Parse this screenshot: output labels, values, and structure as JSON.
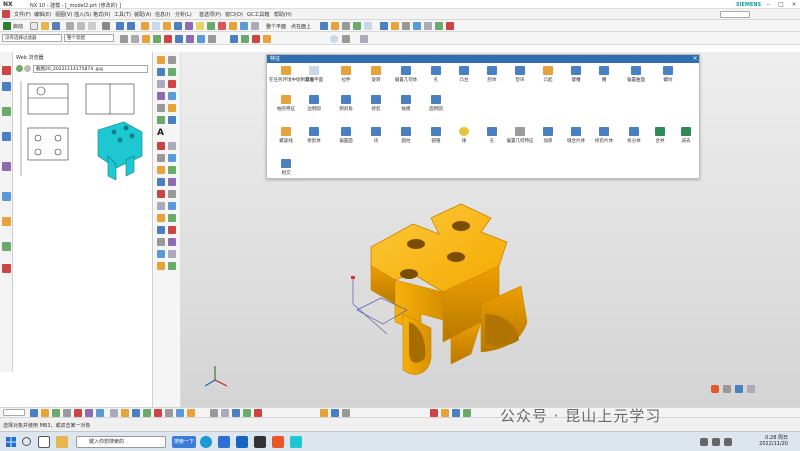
{
  "window": {
    "app_logo": "NX",
    "title": "NX 10 - 建模 - [_model2.prt  (修改的) ]",
    "brand": "SIEMENS",
    "controls": [
      "minimize-icon",
      "maximize-icon",
      "close-icon"
    ]
  },
  "menubar": {
    "items": [
      "文件(F)",
      "编辑(E)",
      "视图(V)",
      "插入(S)",
      "格式(R)",
      "工具(T)",
      "装配(A)",
      "信息(I)",
      "分析(L)",
      "首选项(P)",
      "窗口(O)",
      "GC工具箱",
      "帮助(H)"
    ]
  },
  "toolbar1": {
    "start_label": "启动",
    "snap_label": "整个平面",
    "view_label": "点在面上"
  },
  "selection_bar": {
    "filter_value": "没有选择过滤器",
    "scope_value": "整个装配"
  },
  "nav_panel": {
    "header": "Web 浏览器",
    "address": "截图20_20221114175874 .jpg"
  },
  "feature_dialog": {
    "title": "特征",
    "row1": [
      "在任务环境中绘制草图",
      "基准平面",
      "拉伸",
      "旋转",
      "偏置几何体",
      "孔",
      "凸台",
      "腔体",
      "垫块",
      "凸起",
      "键槽",
      "槽",
      "偏置曲面",
      "螺纹"
    ],
    "row2": [
      "抽壳特征",
      "边倒圆",
      "倒斜角",
      "修剪",
      "拔模",
      "面倒圆"
    ],
    "row3": [
      "螺旋线",
      "修剪体",
      "偏置面",
      "块",
      "圆柱",
      "圆锥",
      "球",
      "孔",
      "偏置几何特征",
      "加厚",
      "缝合片体",
      "修剪片体",
      "拆分体",
      "合并",
      "减去"
    ],
    "row4": [
      "相交"
    ]
  },
  "status": {
    "message": "选择对象并使用 MB3，或双击某一对象"
  },
  "taskbar": {
    "search_placeholder": "键入你想搜索的",
    "active_app": "搜索一下",
    "time": "0:28 周日",
    "date": "2022/11/20"
  },
  "watermark": "公众号 · 昆山上元学习",
  "colors": {
    "part_body": "#f2a900",
    "thumb_part": "#1ec8d2",
    "dialog_title": "#2f6fb0",
    "icon_blue": "#4a7fc1",
    "icon_orange": "#e8a23a"
  }
}
